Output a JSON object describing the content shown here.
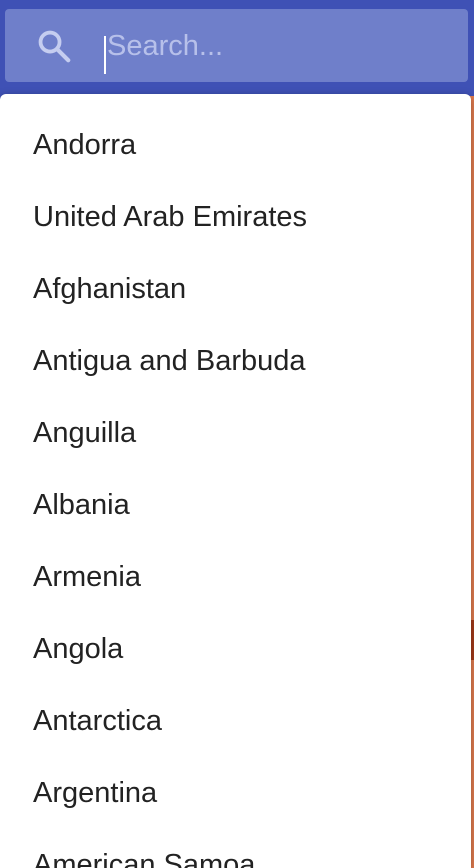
{
  "search": {
    "placeholder": "Search...",
    "value": ""
  },
  "colors": {
    "header_bg": "#3f51b5",
    "search_bg": "#6f7fca",
    "placeholder": "#b7c0ea",
    "list_text": "#222222",
    "accent_edge": "#e07b4f"
  },
  "icons": {
    "search": "search-icon"
  },
  "countries": [
    "Andorra",
    "United Arab Emirates",
    "Afghanistan",
    "Antigua and Barbuda",
    "Anguilla",
    "Albania",
    "Armenia",
    "Angola",
    "Antarctica",
    "Argentina",
    "American Samoa"
  ]
}
